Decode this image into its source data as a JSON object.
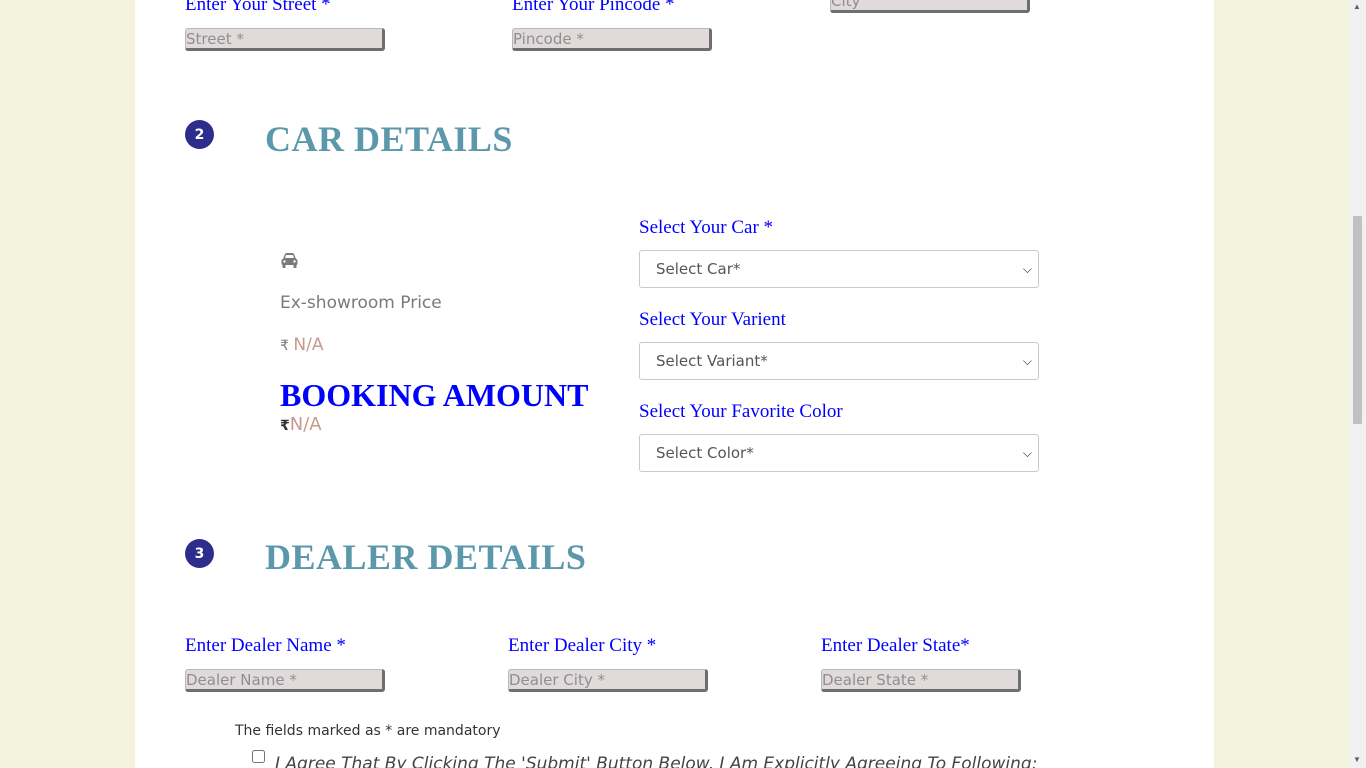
{
  "address": {
    "street_label": "Enter Your Street *",
    "street_placeholder": "Street *",
    "pincode_label": "Enter Your Pincode *",
    "pincode_placeholder": "Pincode *",
    "city_placeholder": "City"
  },
  "car_section": {
    "step": "2",
    "title": "CAR DETAILS",
    "car_icon": "car-icon",
    "ex_showroom_label": "Ex-showroom Price",
    "currency_symbol": "₹",
    "ex_showroom_value": "N/A",
    "booking_amount_label": "BOOKING AMOUNT",
    "booking_amount_value": "N/A",
    "select_car_label": "Select Your Car *",
    "select_car_value": "Select Car*",
    "select_variant_label": "Select Your Varient",
    "select_variant_value": "Select Variant*",
    "select_color_label": "Select Your Favorite Color",
    "select_color_value": "Select Color*"
  },
  "dealer_section": {
    "step": "3",
    "title": "DEALER DETAILS",
    "name_label": "Enter Dealer Name *",
    "name_placeholder": "Dealer Name *",
    "city_label": "Enter Dealer City *",
    "city_placeholder": "Dealer City *",
    "state_label": "Enter Dealer State*",
    "state_placeholder": "Dealer State *"
  },
  "footer": {
    "mandatory_note": "The fields marked as * are mandatory",
    "agree_text": "I Agree That By Clicking The 'Submit' Button Below, I Am Explicitly Agreeing To Following:"
  },
  "colors": {
    "label_blue": "#0000ff",
    "section_teal": "#5b98ab",
    "badge_navy": "#2e2d8c",
    "page_bg": "#f4f3dc"
  }
}
